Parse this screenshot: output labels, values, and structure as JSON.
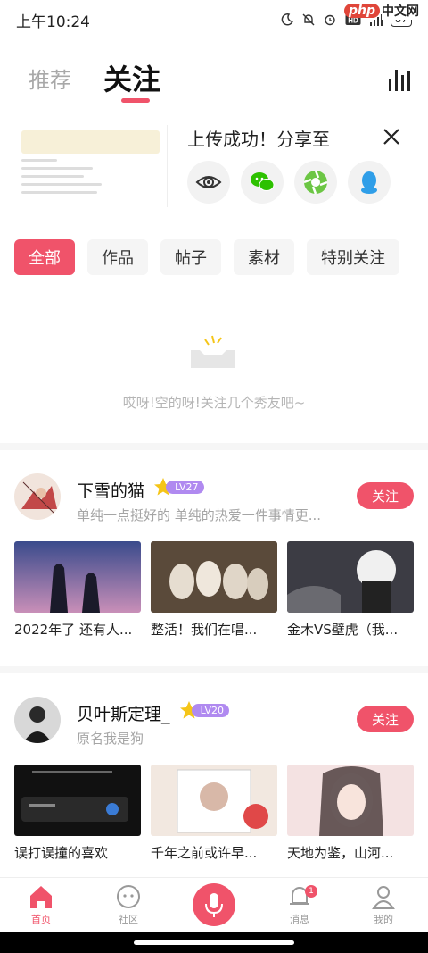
{
  "status_bar": {
    "time": "上午10:24",
    "battery": "87",
    "hd": "HD"
  },
  "watermark": {
    "php": "php",
    "cn": "中文网"
  },
  "top_tabs": {
    "recommend": "推荐",
    "follow": "关注"
  },
  "upload": {
    "title": "上传成功！分享至",
    "share_targets": [
      "eye-icon",
      "wechat-icon",
      "moments-icon",
      "qq-icon"
    ]
  },
  "filters": [
    "全部",
    "作品",
    "帖子",
    "素材",
    "特别关注"
  ],
  "empty_state": {
    "text": "哎呀!空的呀!关注几个秀友吧~"
  },
  "users": [
    {
      "name": "下雪的猫",
      "level": "LV27",
      "desc": "单纯一点挺好的 单纯的热爱一件事情更...",
      "follow": "关注",
      "works": [
        "2022年了 还有人...",
        "整活！我们在唱...",
        "金木VS壁虎（我..."
      ]
    },
    {
      "name": "贝叶斯定理_",
      "level": "LV20",
      "desc": "原名我是狗",
      "follow": "关注",
      "works": [
        "误打误撞的喜欢",
        "千年之前或许早...",
        "天地为鉴，山河..."
      ]
    }
  ],
  "bottom_nav": {
    "home": "首页",
    "community": "社区",
    "messages": "消息",
    "mine": "我的",
    "message_badge": "1"
  },
  "colors": {
    "accent": "#f0536a",
    "level": "#b08af0"
  }
}
